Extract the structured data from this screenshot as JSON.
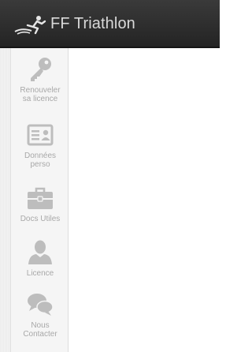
{
  "header": {
    "title": "FF Triathlon",
    "logo_icon": "triathlete-logo-icon"
  },
  "sidebar": {
    "items": [
      {
        "label": "Renouveler\nsa licence",
        "icon": "key-icon"
      },
      {
        "label": "Données\nperso",
        "icon": "id-card-icon"
      },
      {
        "label": "Docs Utiles",
        "icon": "briefcase-icon"
      },
      {
        "label": "Licence",
        "icon": "user-icon"
      },
      {
        "label": "Nous\nContacter",
        "icon": "chat-bubbles-icon"
      }
    ]
  },
  "colors": {
    "header_bg": "#2c2c2c",
    "title": "#d9d9d9",
    "sidebar_bg": "#f5f5f5",
    "icon": "#bdbdbd",
    "label": "#a8a8a8"
  }
}
